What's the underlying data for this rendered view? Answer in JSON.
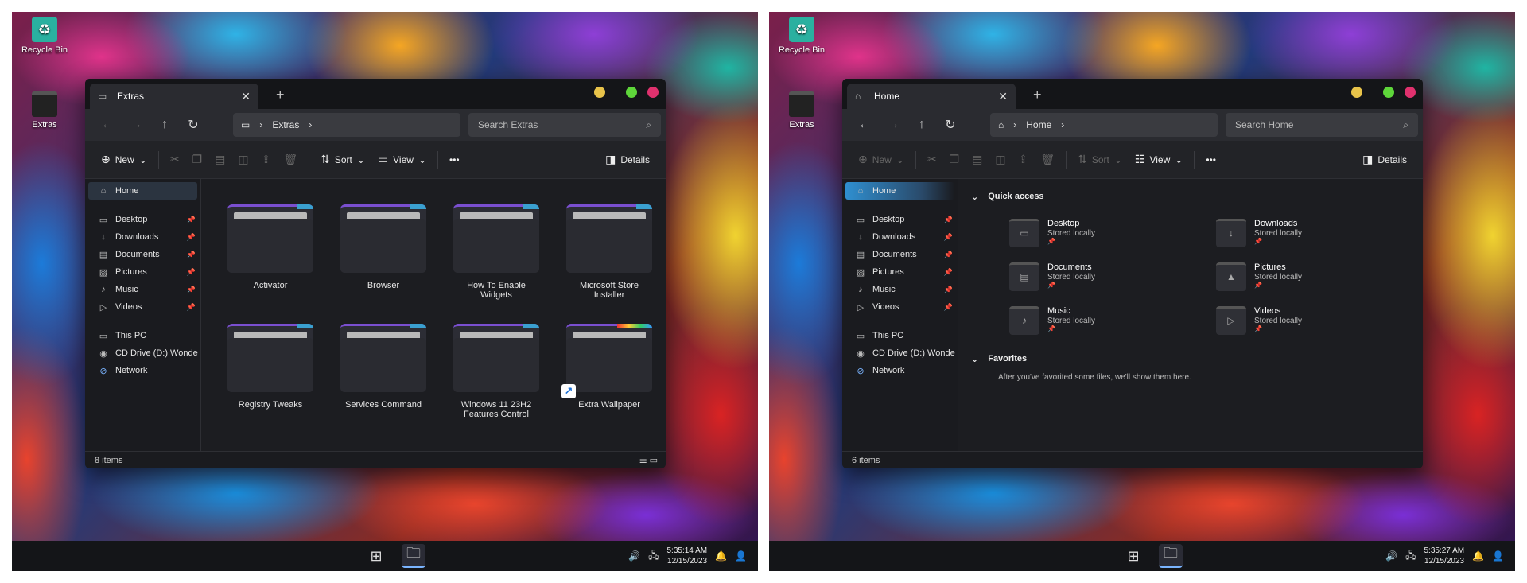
{
  "desktop": {
    "recycle_bin": "Recycle Bin",
    "extras": "Extras"
  },
  "left": {
    "tab_title": "Extras",
    "breadcrumb": "Extras",
    "search_placeholder": "Search Extras",
    "toolbar": {
      "new": "New",
      "sort": "Sort",
      "view": "View",
      "more": "•••",
      "details": "Details"
    },
    "folders": [
      {
        "name": "Activator"
      },
      {
        "name": "Browser"
      },
      {
        "name": "How To Enable Widgets"
      },
      {
        "name": "Microsoft Store Installer"
      },
      {
        "name": "Registry Tweaks"
      },
      {
        "name": "Services Command"
      },
      {
        "name": "Windows 11 23H2 Features Control"
      },
      {
        "name": "Extra Wallpaper"
      }
    ],
    "status": "8 items",
    "time": "5:35:14 AM",
    "date": "12/15/2023"
  },
  "right": {
    "tab_title": "Home",
    "breadcrumb": "Home",
    "search_placeholder": "Search Home",
    "toolbar": {
      "new": "New",
      "sort": "Sort",
      "view": "View",
      "more": "•••",
      "details": "Details"
    },
    "quick_access_title": "Quick access",
    "quick_access": [
      {
        "name": "Desktop",
        "sub": "Stored locally"
      },
      {
        "name": "Downloads",
        "sub": "Stored locally"
      },
      {
        "name": "Documents",
        "sub": "Stored locally"
      },
      {
        "name": "Pictures",
        "sub": "Stored locally"
      },
      {
        "name": "Music",
        "sub": "Stored locally"
      },
      {
        "name": "Videos",
        "sub": "Stored locally"
      }
    ],
    "favorites_title": "Favorites",
    "favorites_hint": "After you've favorited some files, we'll show them here.",
    "status": "6 items",
    "time": "5:35:27 AM",
    "date": "12/15/2023"
  },
  "sidebar": {
    "home": "Home",
    "pinned": [
      "Desktop",
      "Downloads",
      "Documents",
      "Pictures",
      "Music",
      "Videos"
    ],
    "this_pc": "This PC",
    "cd_drive": "CD Drive (D:) Wonde",
    "network": "Network"
  },
  "colors": {
    "close": "#e0316e",
    "maximize": "#5ed63a",
    "minimize": "#e8c34a",
    "accent": "#3aa0d0"
  }
}
